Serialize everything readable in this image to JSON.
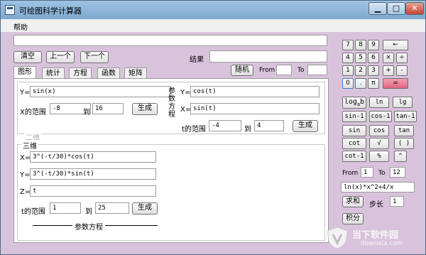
{
  "window": {
    "title": "可绘图科学计算器",
    "min": "▁",
    "max": "□",
    "close": "✕"
  },
  "menu": {
    "help": "帮助"
  },
  "toolbar": {
    "clear": "清空",
    "prev": "上一个",
    "next": "下一个",
    "result_label": "结果",
    "random": "随机",
    "from": "From",
    "to": "To",
    "main_input": "",
    "result_value": "",
    "random_from": "",
    "random_to": ""
  },
  "tabs": [
    "图形",
    "统计",
    "方程",
    "函数",
    "矩阵"
  ],
  "graph": {
    "y_label": "Y=",
    "y_expr": "sin(x)",
    "x_range_label": "X的范围",
    "x_from": "-8",
    "to_label": "到",
    "x_to": "16",
    "generate": "生成",
    "param_title": "参数方程",
    "param_y_label": "Y=",
    "param_y_expr": "cos(t)",
    "param_x_label": "X=",
    "param_x_expr": "sin(t)",
    "t_range_label": "t的范围",
    "t_from": "-4",
    "t_to_label": "到",
    "t_to": "4",
    "param_generate": "生成"
  },
  "three_d": {
    "legend_2d": "二维",
    "legend_3d": "三维",
    "x_label": "X=",
    "x_expr": "3^(-t/30)*cos(t)",
    "y_label": "Y=",
    "y_expr": "3^(-t/30)*sin(t)",
    "z_label": "Z=",
    "z_expr": "t",
    "t_range_label": "t的范围",
    "t_from": "1",
    "to_label": "到",
    "t_to": "25",
    "generate": "生成",
    "footer": "参数方程"
  },
  "keypad": {
    "row1": [
      "7",
      "8",
      "9"
    ],
    "row2": [
      "4",
      "5",
      "6"
    ],
    "row3": [
      "1",
      "2",
      "3"
    ],
    "row4": [
      "0",
      ".",
      "π"
    ],
    "backspace": "←",
    "mul": "×",
    "div": "÷",
    "plus": "+",
    "minus": "-",
    "equals": "="
  },
  "functions": {
    "row1": [
      "log",
      "ln",
      "lg"
    ],
    "log_sub": "a",
    "log_b": "b",
    "row2": [
      "sin-1",
      "cos-1",
      "tan-1"
    ],
    "row3": [
      "sin",
      "cos",
      "tan"
    ],
    "row4": [
      "cot",
      "√",
      "( )"
    ],
    "row5": [
      "cot-1",
      "%",
      "^"
    ]
  },
  "integral": {
    "from": "From",
    "from_value": "1",
    "to": "To",
    "to_value": "12",
    "expr": "ln(x)*x^2+4/x",
    "sum": "求和",
    "step_label": "步长",
    "step_value": "1",
    "integrate": "积分"
  },
  "watermark": {
    "line1": "当下软件园",
    "line2": "downxia.com"
  }
}
